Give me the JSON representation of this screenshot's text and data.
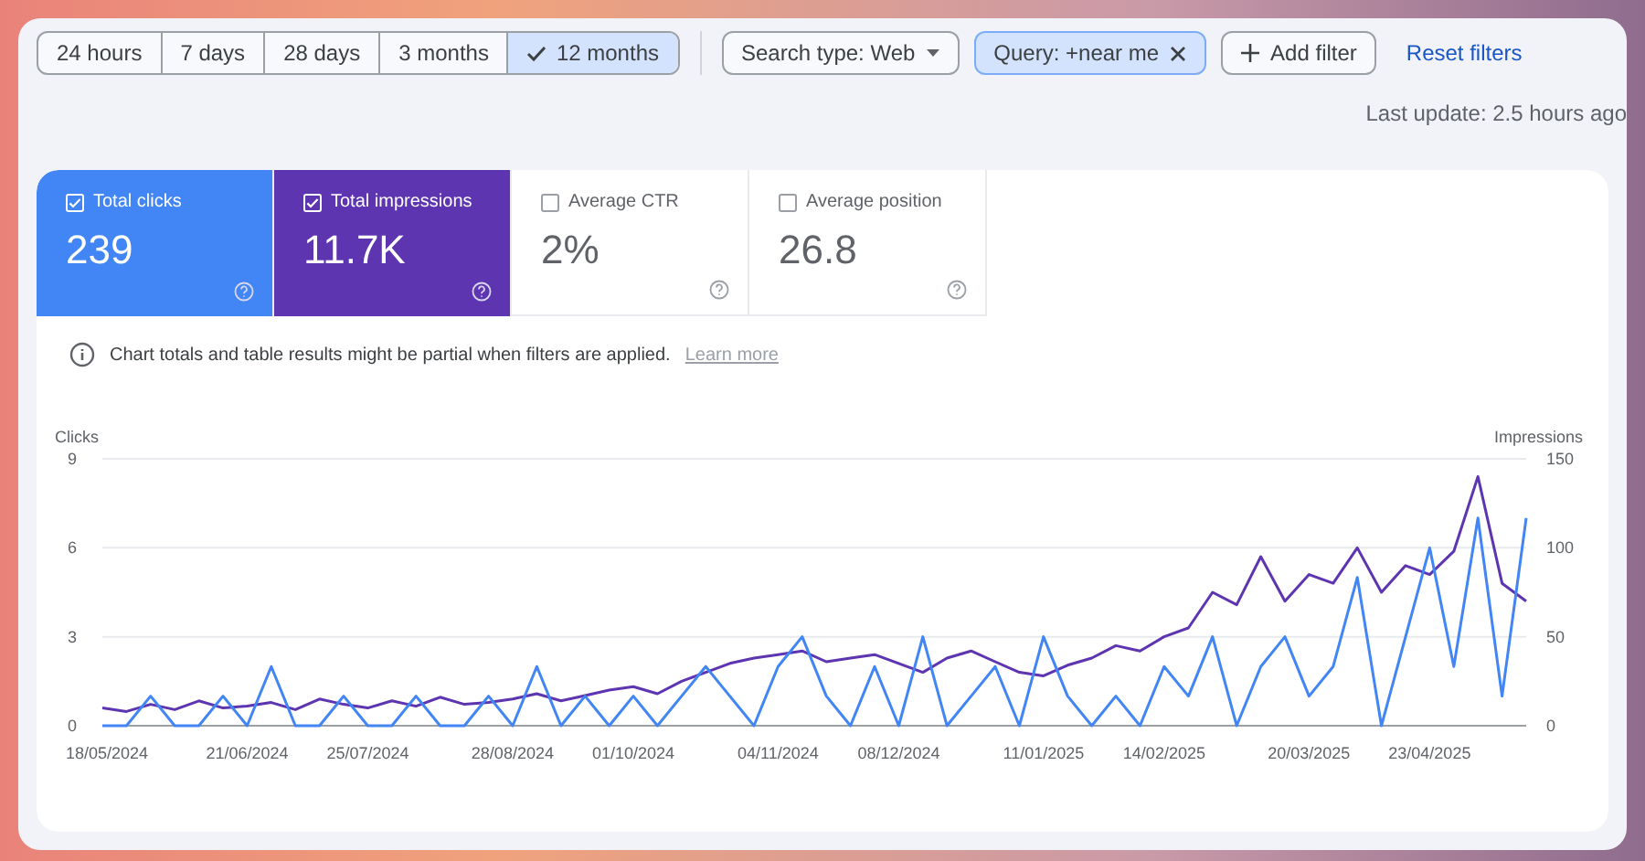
{
  "date_ranges": [
    {
      "label": "24 hours",
      "selected": false
    },
    {
      "label": "7 days",
      "selected": false
    },
    {
      "label": "28 days",
      "selected": false
    },
    {
      "label": "3 months",
      "selected": false
    },
    {
      "label": "12 months",
      "selected": true
    }
  ],
  "filters": {
    "search_type": "Search type: Web",
    "query_chip": "Query: +near me",
    "add_filter": "Add filter",
    "reset": "Reset filters"
  },
  "last_update": "Last update: 2.5 hours ago",
  "metrics": [
    {
      "label": "Total clicks",
      "value": "239",
      "checked": true,
      "color": "#4285f4"
    },
    {
      "label": "Total impressions",
      "value": "11.7K",
      "checked": true,
      "color": "#5e35b1"
    },
    {
      "label": "Average CTR",
      "value": "2%",
      "checked": false
    },
    {
      "label": "Average position",
      "value": "26.8",
      "checked": false
    }
  ],
  "notice": {
    "text": "Chart totals and table results might be partial when filters are applied.",
    "link": "Learn more"
  },
  "chart_data": {
    "type": "line",
    "ylabel": "Clicks",
    "y2label": "Impressions",
    "categories": [
      "18/05/2024",
      null,
      null,
      null,
      null,
      null,
      "21/06/2024",
      null,
      null,
      null,
      null,
      "25/07/2024",
      null,
      null,
      null,
      null,
      null,
      "28/08/2024",
      null,
      null,
      null,
      null,
      "01/10/2024",
      null,
      null,
      null,
      null,
      null,
      "04/11/2024",
      null,
      null,
      null,
      null,
      "08/12/2024",
      null,
      null,
      null,
      null,
      null,
      "11/01/2025",
      null,
      null,
      null,
      null,
      "14/02/2025",
      null,
      null,
      null,
      null,
      null,
      "20/03/2025",
      null,
      null,
      null,
      null,
      "23/04/2025",
      null,
      null,
      null,
      null
    ],
    "ylim": [
      0,
      9
    ],
    "y2lim": [
      0,
      150
    ],
    "yticks": [
      0,
      3,
      6,
      9
    ],
    "y2ticks": [
      0,
      50,
      100,
      150
    ],
    "series": [
      {
        "color": "#4285f4",
        "values": [
          0,
          0,
          1,
          0,
          0,
          1,
          0,
          2,
          0,
          0,
          1,
          0,
          0,
          1,
          0,
          0,
          1,
          0,
          2,
          0,
          1,
          0,
          1,
          0,
          1,
          2,
          1,
          0,
          2,
          3,
          1,
          0,
          2,
          0,
          3,
          0,
          1,
          2,
          0,
          3,
          1,
          0,
          1,
          0,
          2,
          1,
          3,
          0,
          2,
          3,
          1,
          2,
          5,
          0,
          3,
          6,
          2,
          7,
          1,
          7
        ]
      },
      {
        "color": "#5e35b1",
        "axis": "y2",
        "values": [
          10,
          8,
          12,
          9,
          14,
          10,
          11,
          13,
          9,
          15,
          12,
          10,
          14,
          11,
          16,
          12,
          13,
          15,
          18,
          14,
          17,
          20,
          22,
          18,
          25,
          30,
          35,
          38,
          40,
          42,
          36,
          38,
          40,
          35,
          30,
          38,
          42,
          36,
          30,
          28,
          34,
          38,
          45,
          42,
          50,
          55,
          75,
          68,
          95,
          70,
          85,
          80,
          100,
          75,
          90,
          85,
          98,
          140,
          80,
          70
        ]
      }
    ]
  }
}
